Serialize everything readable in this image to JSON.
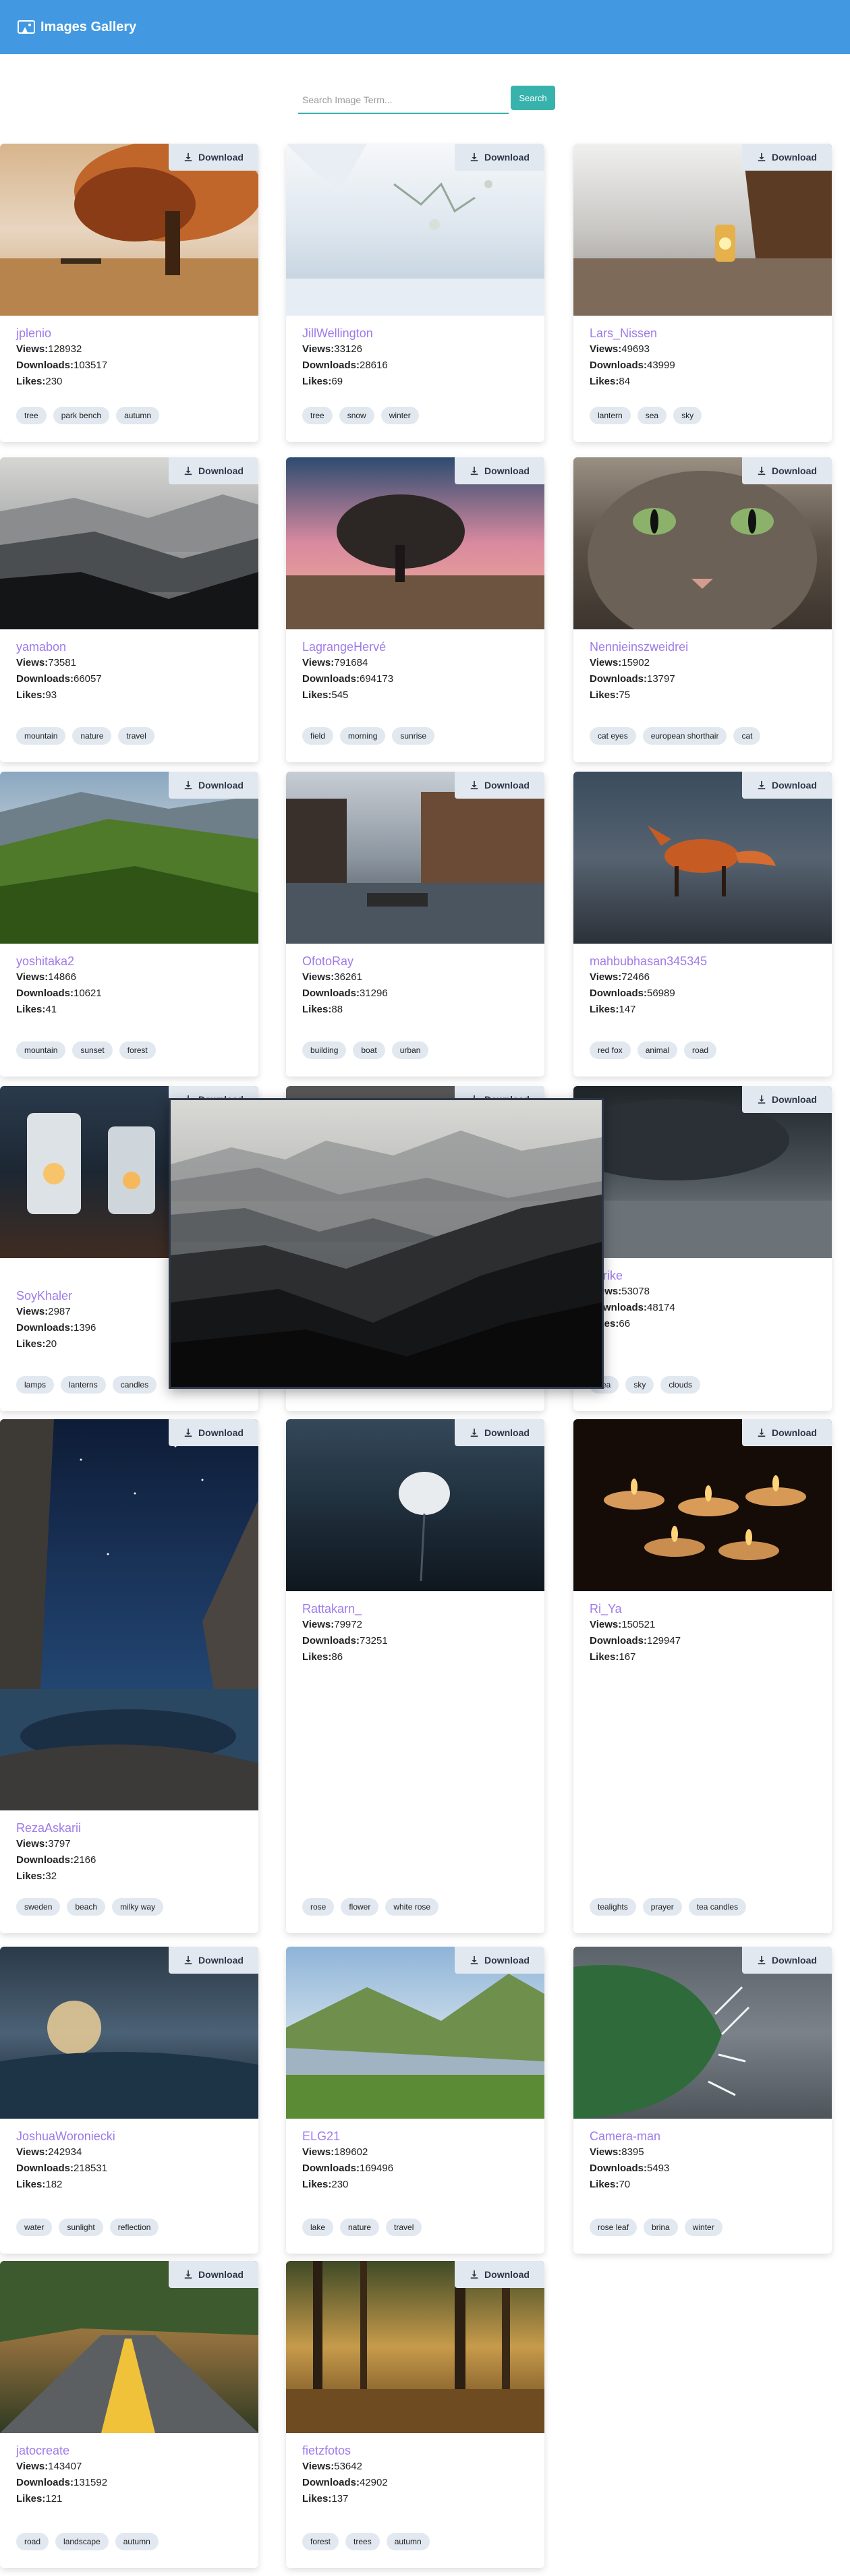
{
  "header": {
    "title": "Images Gallery",
    "brand_color": "#4299e1"
  },
  "search": {
    "placeholder": "Search Image Term...",
    "button_label": "Search",
    "accent": "#38b2ac"
  },
  "download_label": "Download",
  "cards": [
    {
      "user": "jplenio",
      "views": "128932",
      "downloads": "103517",
      "likes": "230",
      "tags": [
        "tree",
        "park bench",
        "autumn"
      ],
      "photo": "tree-icon"
    },
    {
      "user": "JillWellington",
      "views": "33126",
      "downloads": "28616",
      "likes": "69",
      "tags": [
        "tree",
        "snow",
        "winter"
      ],
      "photo": "snow-icon"
    },
    {
      "user": "Lars_Nissen",
      "views": "49693",
      "downloads": "43999",
      "likes": "84",
      "tags": [
        "lantern",
        "sea",
        "sky"
      ],
      "photo": "lantern-icon"
    },
    {
      "user": "yamabon",
      "views": "73581",
      "downloads": "66057",
      "likes": "93",
      "tags": [
        "mountain",
        "nature",
        "travel"
      ],
      "photo": "mountain-icon"
    },
    {
      "user": "LagrangeHervé",
      "views": "791684",
      "downloads": "694173",
      "likes": "545",
      "tags": [
        "field",
        "morning",
        "sunrise"
      ],
      "photo": "field-icon"
    },
    {
      "user": "Nennieinszweidrei",
      "views": "15902",
      "downloads": "13797",
      "likes": "75",
      "tags": [
        "cat eyes",
        "european shorthair",
        "cat"
      ],
      "photo": "cat-icon"
    },
    {
      "user": "yoshitaka2",
      "views": "14866",
      "downloads": "10621",
      "likes": "41",
      "tags": [
        "mountain",
        "sunset",
        "forest"
      ],
      "photo": "forest-icon"
    },
    {
      "user": "OfotoRay",
      "views": "36261",
      "downloads": "31296",
      "likes": "88",
      "tags": [
        "building",
        "boat",
        "urban"
      ],
      "photo": "canal-icon"
    },
    {
      "user": "mahbubhasan345345",
      "views": "72466",
      "downloads": "56989",
      "likes": "147",
      "tags": [
        "red fox",
        "animal",
        "road"
      ],
      "photo": "fox-icon"
    },
    {
      "user": "SoyKhaler",
      "views": "2987",
      "downloads": "1396",
      "likes": "20",
      "tags": [
        "lamps",
        "lanterns",
        "candles"
      ],
      "photo": "lamps-icon"
    },
    {
      "user": "",
      "views": "",
      "downloads": "",
      "likes": "",
      "tags": [],
      "photo": "hidden"
    },
    {
      "user": "enrike",
      "views": "53078",
      "downloads": "48174",
      "likes": "66",
      "tags": [
        "sea",
        "sky",
        "clouds"
      ],
      "photo": "storm-icon"
    },
    {
      "user": "RezaAskarii",
      "views": "3797",
      "downloads": "2166",
      "likes": "32",
      "tags": [
        "sweden",
        "beach",
        "milky way"
      ],
      "photo": "milkyway-icon"
    },
    {
      "user": "Rattakarn_",
      "views": "79972",
      "downloads": "73251",
      "likes": "86",
      "tags": [
        "rose",
        "flower",
        "white rose"
      ],
      "photo": "rose-icon"
    },
    {
      "user": "Ri_Ya",
      "views": "150521",
      "downloads": "129947",
      "likes": "167",
      "tags": [
        "tealights",
        "prayer",
        "tea candles"
      ],
      "photo": "candles-icon"
    },
    {
      "user": "JoshuaWoroniecki",
      "views": "242934",
      "downloads": "218531",
      "likes": "182",
      "tags": [
        "water",
        "sunlight",
        "reflection"
      ],
      "photo": "water-icon"
    },
    {
      "user": "ELG21",
      "views": "189602",
      "downloads": "169496",
      "likes": "230",
      "tags": [
        "lake",
        "nature",
        "travel"
      ],
      "photo": "lake-icon"
    },
    {
      "user": "Camera-man",
      "views": "8395",
      "downloads": "5493",
      "likes": "70",
      "tags": [
        "rose leaf",
        "brina",
        "winter"
      ],
      "photo": "leaf-icon"
    },
    {
      "user": "jatocreate",
      "views": "143407",
      "downloads": "131592",
      "likes": "121",
      "tags": [
        "road",
        "landscape",
        "autumn"
      ],
      "photo": "road-icon"
    },
    {
      "user": "fietzfotos",
      "views": "53642",
      "downloads": "42902",
      "likes": "137",
      "tags": [
        "forest",
        "trees",
        "autumn"
      ],
      "photo": "woods-icon"
    }
  ],
  "labels": {
    "views": "Views:",
    "downloads": "Downloads:",
    "likes": "Likes:"
  }
}
